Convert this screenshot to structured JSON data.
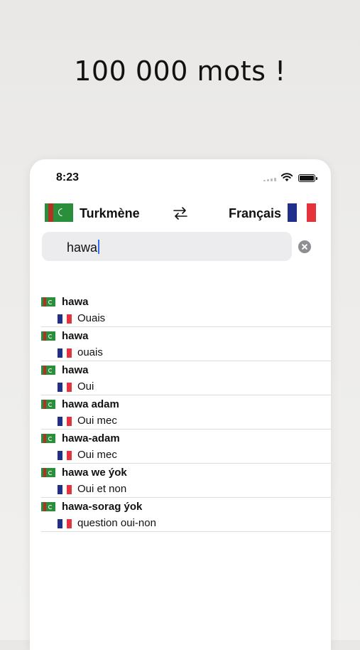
{
  "headline": "100 000 mots !",
  "status": {
    "time": "8:23"
  },
  "colors": {
    "tm_green": "#2a8f3a",
    "tm_red": "#b33224",
    "fr_blue": "#1f2f8a",
    "fr_red": "#e4333a",
    "caret": "#2e6cf6"
  },
  "languages": {
    "source": "Turkmène",
    "target": "Français",
    "swap_icon": "swap-arrows-icon"
  },
  "search": {
    "value": "hawa"
  },
  "results": [
    {
      "term": "hawa",
      "translation": "Ouais"
    },
    {
      "term": "hawa",
      "translation": "ouais"
    },
    {
      "term": "hawa",
      "translation": "Oui"
    },
    {
      "term": "hawa adam",
      "translation": "Oui mec"
    },
    {
      "term": "hawa-adam",
      "translation": "Oui mec"
    },
    {
      "term": "hawa we ýok",
      "translation": "Oui et non"
    },
    {
      "term": "hawa-sorag ýok",
      "translation": "question oui-non"
    }
  ]
}
